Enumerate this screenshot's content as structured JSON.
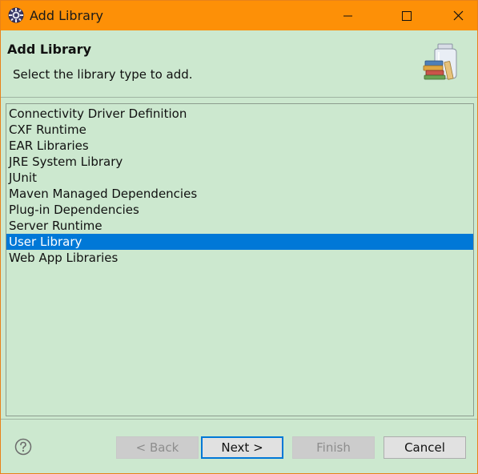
{
  "window": {
    "title": "Add Library",
    "title_bar_color": "#fd9007"
  },
  "header": {
    "title": "Add Library",
    "subtitle": "Select the library type to add."
  },
  "library_types": {
    "items": [
      {
        "label": "Connectivity Driver Definition",
        "selected": false
      },
      {
        "label": "CXF Runtime",
        "selected": false
      },
      {
        "label": "EAR Libraries",
        "selected": false
      },
      {
        "label": "JRE System Library",
        "selected": false
      },
      {
        "label": "JUnit",
        "selected": false
      },
      {
        "label": "Maven Managed Dependencies",
        "selected": false
      },
      {
        "label": "Plug-in Dependencies",
        "selected": false
      },
      {
        "label": "Server Runtime",
        "selected": false
      },
      {
        "label": "User Library",
        "selected": true
      },
      {
        "label": "Web App Libraries",
        "selected": false
      }
    ],
    "selection_color": "#0078d7"
  },
  "footer": {
    "back_label": "< Back",
    "next_label": "Next >",
    "finish_label": "Finish",
    "cancel_label": "Cancel",
    "back_enabled": false,
    "finish_enabled": false
  },
  "icons": {
    "app": "eclipse-gear-icon",
    "header": "library-books-jar-icon",
    "help": "help-question-icon",
    "minimize": "minimize-icon",
    "maximize": "maximize-icon",
    "close": "close-icon"
  },
  "background_color": "#cce8cf"
}
